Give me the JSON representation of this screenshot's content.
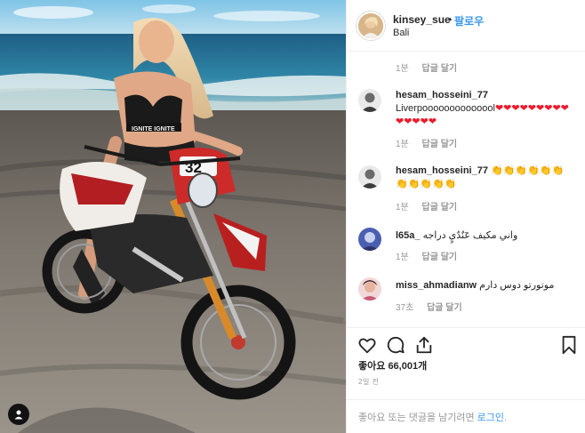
{
  "post": {
    "username": "kinsey_sue",
    "separator": "•",
    "follow_label": "팔로우",
    "location": "Bali",
    "image_jersey_text": "IGNITE IGNITE",
    "bike_number": "32"
  },
  "comments": [
    {
      "meta_time": "1분",
      "reply_label": "답글 달기"
    },
    {
      "username": "hesam_hosseini_77",
      "text": "Liverpoooooooooooool",
      "emoji": "❤❤❤❤❤❤❤❤❤❤❤❤❤❤",
      "meta_time": "1분",
      "reply_label": "답글 달기"
    },
    {
      "username": "hesam_hosseini_77",
      "text": "",
      "emoji": "👏👏👏👏👏👏👏👏👏👏👏",
      "meta_time": "1분",
      "reply_label": "답글 달기"
    },
    {
      "username": "l65a_",
      "text": "واني مكيف عٓنٌدٌيٍ دراجه",
      "meta_time": "1분",
      "reply_label": "답글 달기"
    },
    {
      "username": "miss_ahmadianw",
      "text": "موتورتو دوس دارم",
      "meta_time": "37초",
      "reply_label": "답글 달기"
    }
  ],
  "actions": {
    "icons": [
      "heart-icon",
      "comment-icon",
      "share-icon",
      "bookmark-icon"
    ],
    "likes_label": "좋아요",
    "likes_count": "66,001개",
    "time_ago": "2일 전",
    "login_prompt": "좋아요 또는 댓글을 남기려면",
    "login_link": "로그인",
    "login_suffix": "."
  },
  "colors": {
    "accent": "#3897f0",
    "heart": "#ed1b2e",
    "muted": "#999999",
    "text": "#262626"
  }
}
